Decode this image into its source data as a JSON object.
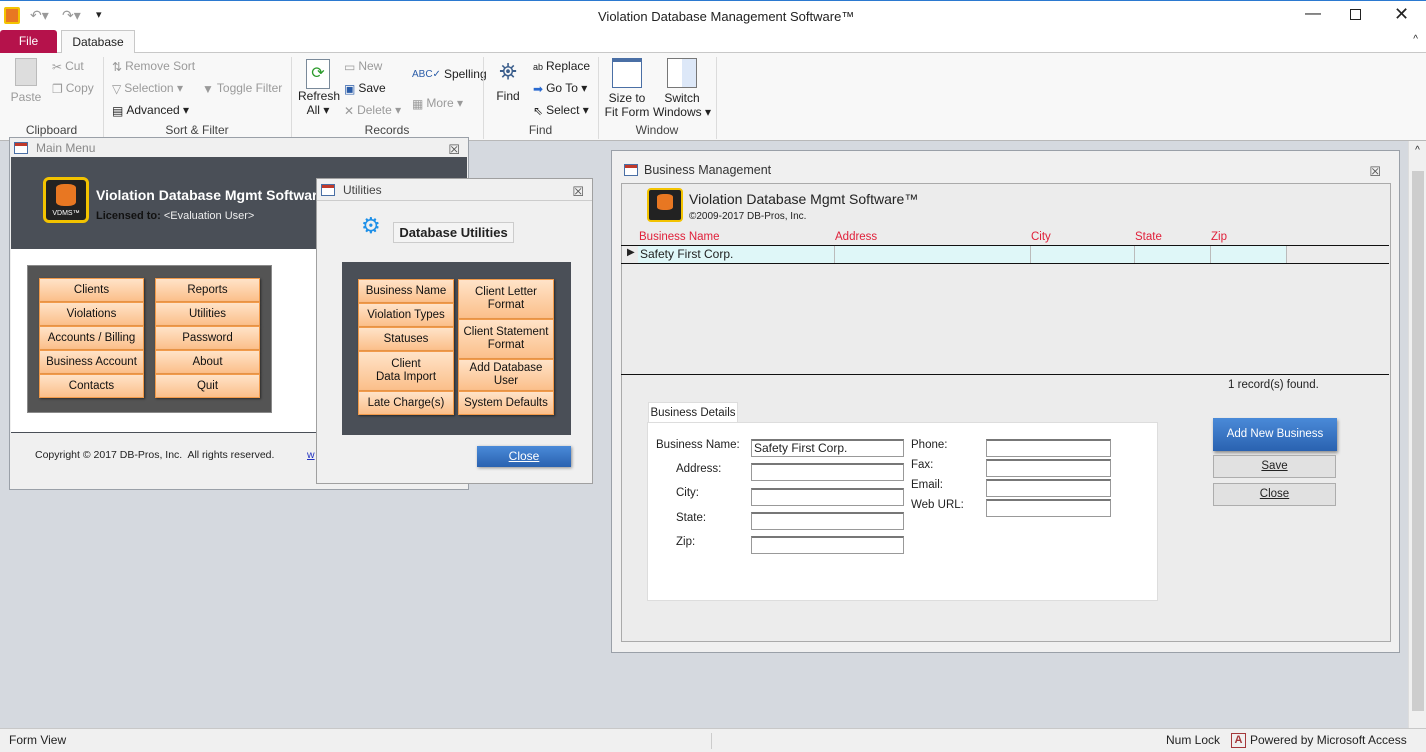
{
  "app": {
    "title": "Violation Database Management Software™"
  },
  "tabs": {
    "file": "File",
    "database": "Database"
  },
  "ribbon": {
    "clipboard": {
      "label": "Clipboard",
      "paste": "Paste",
      "cut": "Cut",
      "copy": "Copy"
    },
    "sort_filter": {
      "label": "Sort & Filter",
      "remove_sort": "Remove Sort",
      "selection": "Selection",
      "toggle_filter": "Toggle Filter",
      "advanced": "Advanced"
    },
    "records": {
      "label": "Records",
      "refresh": "Refresh",
      "refresh2": "All",
      "new": "New",
      "save": "Save",
      "delete": "Delete",
      "spelling": "Spelling",
      "more": "More"
    },
    "find": {
      "label": "Find",
      "find": "Find",
      "replace": "Replace",
      "goto": "Go To",
      "select": "Select"
    },
    "window": {
      "label": "Window",
      "size1": "Size to",
      "size2": "Fit Form",
      "switch1": "Switch",
      "switch2": "Windows"
    }
  },
  "main_menu": {
    "title": "Main Menu",
    "app_name": "Violation Database Mgmt Software™",
    "licensed_label": "Licensed to:",
    "licensed_user": "<Evaluation User>",
    "logo_text": "VDMS™",
    "buttons": [
      "Clients",
      "Violations",
      "Accounts / Billing",
      "Business Account",
      "Contacts",
      "Reports",
      "Utilities",
      "Password",
      "About",
      "Quit"
    ],
    "copyright": "Copyright © 2017 DB-Pros, Inc.  All rights reserved.",
    "link": "w"
  },
  "utilities": {
    "title": "Utilities",
    "heading": "Database Utilities",
    "left": [
      "Business Name",
      "Violation Types",
      "Statuses",
      "Client\nData Import",
      "Late Charge(s)"
    ],
    "right": [
      "Client Letter\nFormat",
      "Client Statement\nFormat",
      "Add Database\nUser",
      "System Defaults"
    ],
    "close": "Close"
  },
  "business": {
    "title": "Business Management",
    "app_name": "Violation Database Mgmt Software™",
    "copyright": "©2009-2017 DB-Pros, Inc.",
    "columns": [
      "Business Name",
      "Address",
      "City",
      "State",
      "Zip"
    ],
    "rows": [
      [
        "Safety First Corp.",
        "",
        "",
        "",
        ""
      ]
    ],
    "record_count": "1",
    "record_suffix": "record(s) found.",
    "tab": "Business Details",
    "fields": {
      "business_name_label": "Business Name:",
      "business_name": "Safety First Corp.",
      "address_label": "Address:",
      "city_label": "City:",
      "state_label": "State:",
      "zip_label": "Zip:",
      "phone_label": "Phone:",
      "fax_label": "Fax:",
      "email_label": "Email:",
      "web_label": "Web URL:"
    },
    "add": "Add New Business",
    "save": "Save",
    "close": "Close"
  },
  "status": {
    "view": "Form View",
    "numlock": "Num Lock",
    "powered": "Powered by Microsoft Access"
  }
}
